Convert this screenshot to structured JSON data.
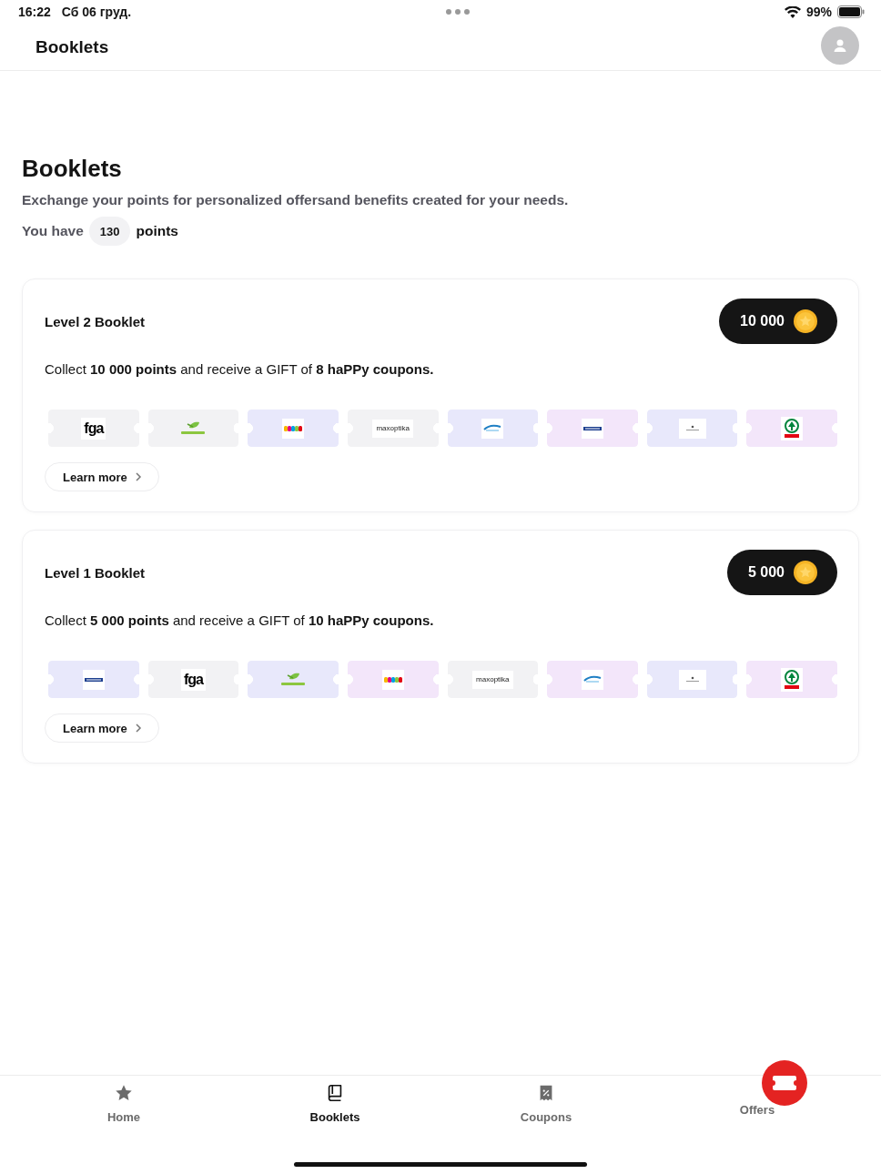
{
  "status_bar": {
    "time": "16:22",
    "date": "Сб 06 груд.",
    "battery": "99%"
  },
  "header": {
    "title": "Booklets"
  },
  "page": {
    "title": "Booklets",
    "subtitle": "Exchange your points for personalized offersand benefits created for your needs.",
    "points_prefix": "You have",
    "points": "130",
    "points_suffix": "points"
  },
  "booklets": [
    {
      "title": "Level 2 Booklet",
      "price": "10 000",
      "description": "Collect **10 000 points** and receive a GIFT of **8 haPPy coupons.**",
      "coupons": [
        {
          "kind": "monogram",
          "label": "fga",
          "color": "#f2f2f4"
        },
        {
          "kind": "leaf",
          "color": "#f2f2f4"
        },
        {
          "kind": "blocks",
          "color": "#e8e8fb"
        },
        {
          "kind": "wordmark",
          "label": "maxoptika",
          "color": "#f2f2f4"
        },
        {
          "kind": "wave",
          "color": "#e8e8fb"
        },
        {
          "kind": "stripe",
          "color": "#f3e6fa"
        },
        {
          "kind": "mark",
          "color": "#e8e8fb"
        },
        {
          "kind": "tree",
          "color": "#f3e6fa"
        }
      ],
      "button": "Learn more"
    },
    {
      "title": "Level 1 Booklet",
      "price": "5 000",
      "description": "Collect **5 000 points** and receive a GIFT of **10 haPPy coupons.**",
      "coupons": [
        {
          "kind": "stripe",
          "color": "#e8e8fb"
        },
        {
          "kind": "monogram",
          "label": "fga",
          "color": "#f2f2f4"
        },
        {
          "kind": "leaf",
          "color": "#e8e8fb"
        },
        {
          "kind": "blocks",
          "color": "#f3e6fa"
        },
        {
          "kind": "wordmark",
          "label": "maxoptika",
          "color": "#f2f2f4"
        },
        {
          "kind": "wave",
          "color": "#f3e6fa"
        },
        {
          "kind": "mark",
          "color": "#e8e8fb"
        },
        {
          "kind": "tree",
          "color": "#f3e6fa"
        }
      ],
      "button": "Learn more"
    }
  ],
  "tab_bar": [
    {
      "label": "Home",
      "kind": "star",
      "selected": false
    },
    {
      "label": "Booklets",
      "kind": "book",
      "selected": true
    },
    {
      "label": "Coupons",
      "kind": "receipt",
      "selected": false
    },
    {
      "label": "Offers",
      "kind": "ticket",
      "selected": false
    }
  ]
}
